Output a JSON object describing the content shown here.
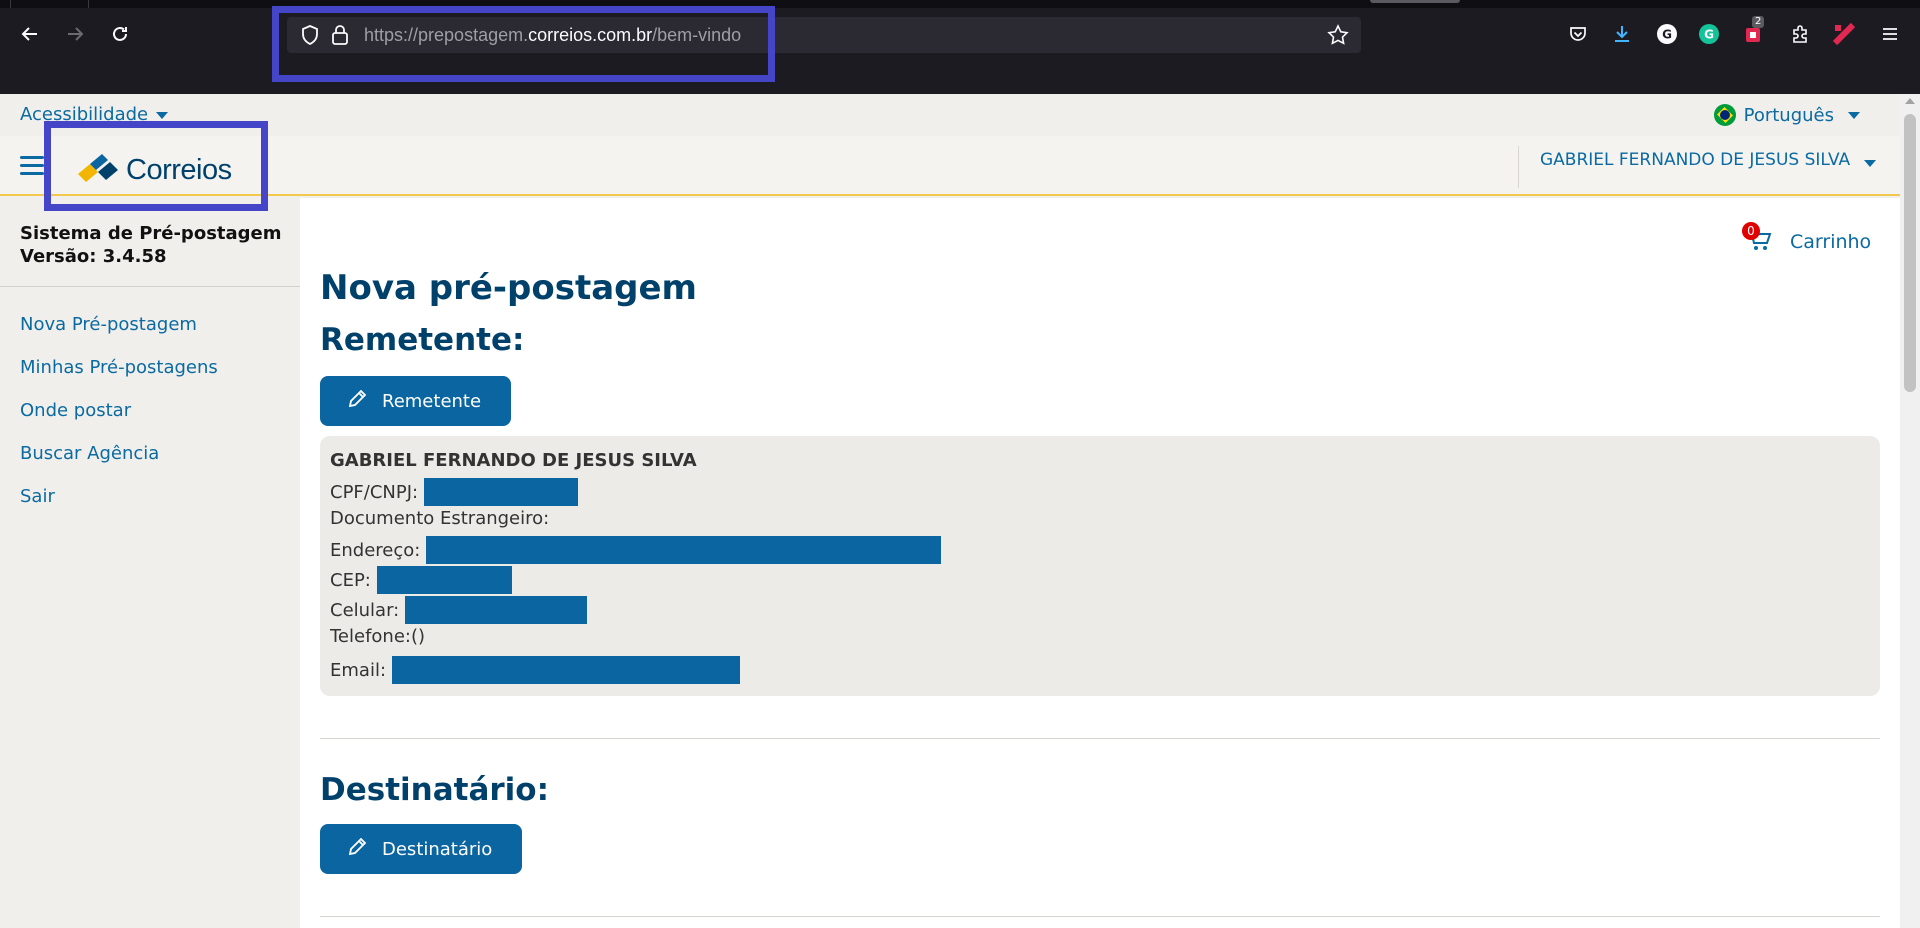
{
  "browser": {
    "url_prefix": "https://prepostagem.",
    "url_domain": "correios.com.br",
    "url_path": "/bem-vindo",
    "ext_badge": "2"
  },
  "topbar": {
    "accessibility_label": "Acessibilidade",
    "language_label": "Português"
  },
  "header": {
    "logo_text": "Correios",
    "user_name": "GABRIEL FERNANDO DE JESUS SILVA"
  },
  "sidebar": {
    "system_title": "Sistema de Pré-postagem",
    "version": "Versão: 3.4.58",
    "items": [
      {
        "label": "Nova Pré-postagem"
      },
      {
        "label": "Minhas Pré-postagens"
      },
      {
        "label": "Onde postar"
      },
      {
        "label": "Buscar Agência"
      },
      {
        "label": "Sair"
      }
    ]
  },
  "cart": {
    "count": "0",
    "label": "Carrinho"
  },
  "main": {
    "page_title": "Nova pré-postagem",
    "sender_title": "Remetente:",
    "sender_button": "Remetente",
    "sender": {
      "name": "GABRIEL FERNANDO DE JESUS SILVA",
      "cpf_label": "CPF/CNPJ:",
      "foreign_doc_label": "Documento Estrangeiro:",
      "address_label": "Endereço:",
      "cep_label": "CEP:",
      "mobile_label": "Celular:",
      "phone_label": "Telefone:()",
      "email_label": "Email:"
    },
    "recipient_title": "Destinatário:",
    "recipient_button": "Destinatário"
  },
  "colors": {
    "brand_blue": "#0a65a0",
    "heading_blue": "#00416b",
    "highlight": "#4545c7",
    "accent_yellow": "#f2c94c"
  }
}
